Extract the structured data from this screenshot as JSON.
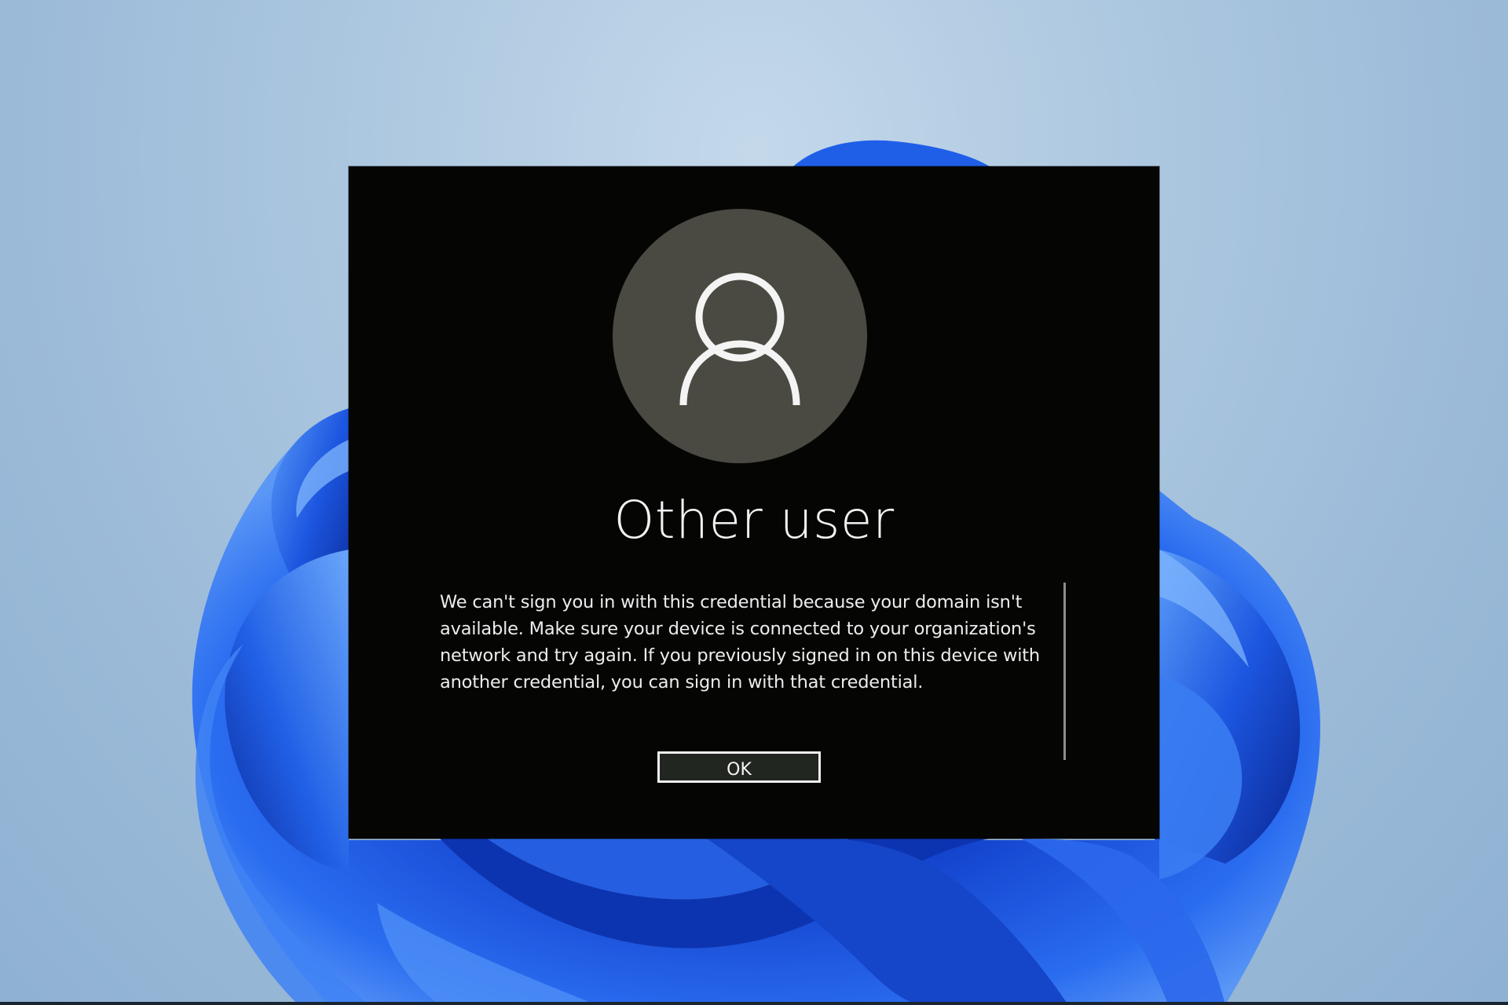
{
  "screen": {
    "wallpaper": "windows-11-bloom",
    "colors": {
      "background": "#a9c4de",
      "bloom_dark": "#0b2fa8",
      "bloom_mid": "#1f5fe8",
      "bloom_light": "#4d8df5",
      "dialog_background": "#050604",
      "avatar_circle": "#4a4a42",
      "text": "#f2f2f2"
    }
  },
  "dialog": {
    "avatar_icon": "user-icon",
    "user_name": "Other user",
    "message": "We can't sign you in with this credential because your domain isn't available. Make sure your device is connected to your organization's network and try again. If you previously signed in on this device with another credential, you can sign in with that credential.",
    "ok_label": "OK"
  }
}
